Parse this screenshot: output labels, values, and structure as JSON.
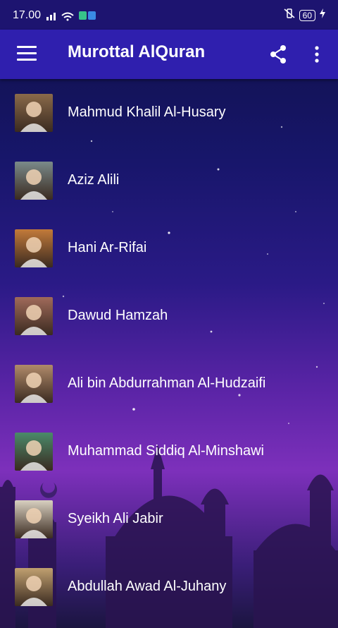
{
  "status": {
    "time": "17.00",
    "battery": "60"
  },
  "appbar": {
    "title": "Murottal AlQuran",
    "icons": [
      "menu-icon",
      "share-icon",
      "more-vert-icon"
    ]
  },
  "reciters": [
    {
      "name": "Mahmud Khalil Al-Husary",
      "avatar_color": "#8a6a4a"
    },
    {
      "name": "Aziz Alili",
      "avatar_color": "#7a8a8a"
    },
    {
      "name": "Hani Ar-Rifai",
      "avatar_color": "#c27a3a"
    },
    {
      "name": "Dawud Hamzah",
      "avatar_color": "#a06a5a"
    },
    {
      "name": "Ali bin Abdurrahman Al-Hudzaifi",
      "avatar_color": "#b08a6a"
    },
    {
      "name": "Muhammad Siddiq Al-Minshawi",
      "avatar_color": "#4a8a6a"
    },
    {
      "name": "Syeikh Ali Jabir",
      "avatar_color": "#d8d0c0"
    },
    {
      "name": "Abdullah Awad Al-Juhany",
      "avatar_color": "#c0a070"
    }
  ]
}
